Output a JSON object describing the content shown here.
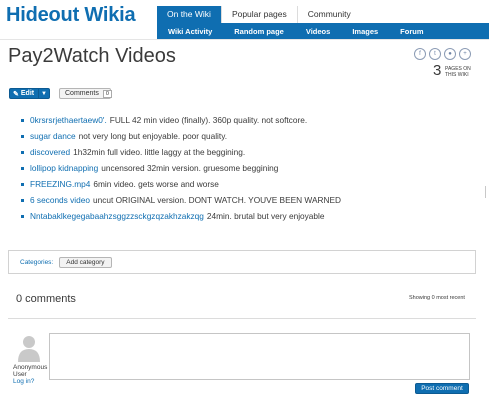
{
  "wiki": {
    "name": "Hideout Wikia"
  },
  "nav": {
    "top_tabs": [
      "On the Wiki",
      "Popular pages",
      "Community"
    ],
    "sub_items": [
      "Wiki Activity",
      "Random page",
      "Videos",
      "Images",
      "Forum"
    ]
  },
  "page": {
    "title": "Pay2Watch Videos",
    "pages_count": "3",
    "pages_label": "PAGES ON THIS WIKI"
  },
  "social_icons": [
    "facebook-icon",
    "twitter-icon",
    "reddit-icon",
    "plus-icon"
  ],
  "toolbar": {
    "edit_label": "Edit",
    "comments_label": "Comments",
    "comments_count": "0"
  },
  "videos": [
    {
      "link": "0krsrsrjethaertaew0'.",
      "desc": "FULL 42 min video (finally). 360p quality. not softcore."
    },
    {
      "link": "sugar dance",
      "desc": "not very long but enjoyable. poor quality."
    },
    {
      "link": "discovered",
      "desc": "1h32min full video. little laggy at the beggining."
    },
    {
      "link": "lollipop kidnapping",
      "desc": "uncensored 32min version. gruesome beggining"
    },
    {
      "link": "FREEZING.mp4",
      "desc": "6min video. gets worse and worse"
    },
    {
      "link": "6 seconds video",
      "desc": "uncut ORIGINAL version. DONT WATCH. YOUVE BEEN WARNED"
    },
    {
      "link": "Nntabaklkegegabaahzsggzzsckgzqzakhzakzqg",
      "desc": "24min. brutal but very enjoyable"
    }
  ],
  "categories": {
    "label": "Categories:",
    "add_label": "Add category"
  },
  "comments_section": {
    "count_label": "0 comments",
    "sort_label": "Showing 0 most recent",
    "user_name": "Anonymous User",
    "login_label": "Log in?",
    "post_label": "Post comment"
  },
  "colors": {
    "accent": "#0f6eb1",
    "text": "#3a3a3a",
    "border": "#d2d2d2"
  }
}
